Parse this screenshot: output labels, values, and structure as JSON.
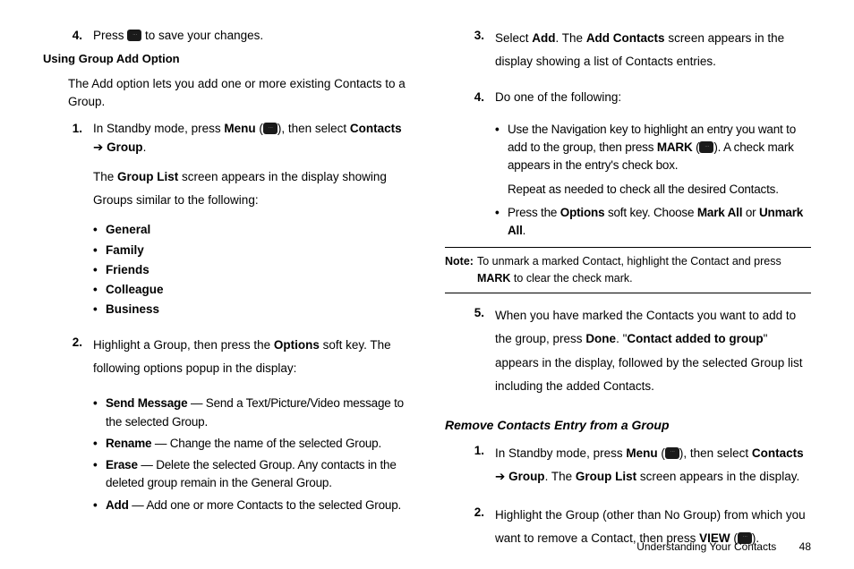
{
  "col_left": {
    "step4": {
      "num": "4.",
      "pre": "Press ",
      "post": " to save your changes."
    },
    "heading_using": "Using Group Add Option",
    "intro": "The Add option lets you add one or more existing Contacts to a Group.",
    "step1": {
      "num": "1.",
      "pre": "In Standby mode, press ",
      "menu": "Menu",
      "mid": " (",
      "mid2": "), then select ",
      "contacts": "Contacts",
      "arrow": " ➔ ",
      "group": "Group",
      "end": "."
    },
    "step1b_pre": "The ",
    "step1b_bold": "Group List",
    "step1b_post": " screen appears in the display showing Groups similar to the following:",
    "groups": [
      "General",
      "Family",
      "Friends",
      "Colleague",
      "Business"
    ],
    "step2": {
      "num": "2.",
      "pre": "Highlight a Group, then press the ",
      "options": "Options",
      "post": " soft key. The following options popup in the display:"
    },
    "opts": [
      {
        "b": "Send Message",
        "t": " — Send a Text/Picture/Video message to the selected Group."
      },
      {
        "b": "Rename",
        "t": " — Change the name of the selected Group."
      },
      {
        "b": "Erase",
        "t": " — Delete the selected Group. Any contacts in the deleted group remain in the General Group."
      },
      {
        "b": "Add",
        "t": " — Add one or more Contacts to the selected Group."
      }
    ]
  },
  "col_right": {
    "step3": {
      "num": "3.",
      "pre": "Select ",
      "add": "Add",
      "mid": ". The ",
      "addc": "Add Contacts",
      "post": " screen appears in the display showing a list of Contacts entries."
    },
    "step4": {
      "num": "4.",
      "text": "Do one of the following:"
    },
    "sub1": {
      "pre": "Use the Navigation key to highlight an entry you want to add to the group, then press ",
      "mark": "MARK",
      "mid": " (",
      "post": "). A check mark appears in the entry's check box."
    },
    "sub1b": "Repeat as needed to check all the desired Contacts.",
    "sub2": {
      "pre": "Press the ",
      "opt": "Options",
      "mid": " soft key. Choose ",
      "ma": "Mark All",
      "or": " or ",
      "ua": "Unmark All",
      "end": "."
    },
    "note": {
      "label": "Note:",
      "pre": " To unmark a marked Contact, highlight the Contact and press ",
      "mark": "MARK",
      "post": " to clear the check mark."
    },
    "step5": {
      "num": "5.",
      "pre": "When you have marked the Contacts you want to add to the group, press ",
      "done": "Done",
      "mid": ". \"",
      "cag": "Contact added to group",
      "post": "\" appears in the display, followed by the selected Group list including the added Contacts."
    },
    "heading_remove": "Remove Contacts Entry from a Group",
    "rstep1": {
      "num": "1.",
      "pre": "In Standby mode, press ",
      "menu": "Menu",
      "mid": " (",
      "mid2": "), then select ",
      "contacts": "Contacts",
      "arrow": " ➔ ",
      "group": "Group",
      "mid3": ". The ",
      "glist": "Group List",
      "post": " screen appears in the display."
    },
    "rstep2": {
      "num": "2.",
      "pre": "Highlight the Group (other than No Group) from which you want to remove a Contact, then press ",
      "view": "VIEW",
      "mid": " (",
      "post": ")."
    }
  },
  "footer": {
    "title": "Understanding Your Contacts",
    "page": "48"
  }
}
